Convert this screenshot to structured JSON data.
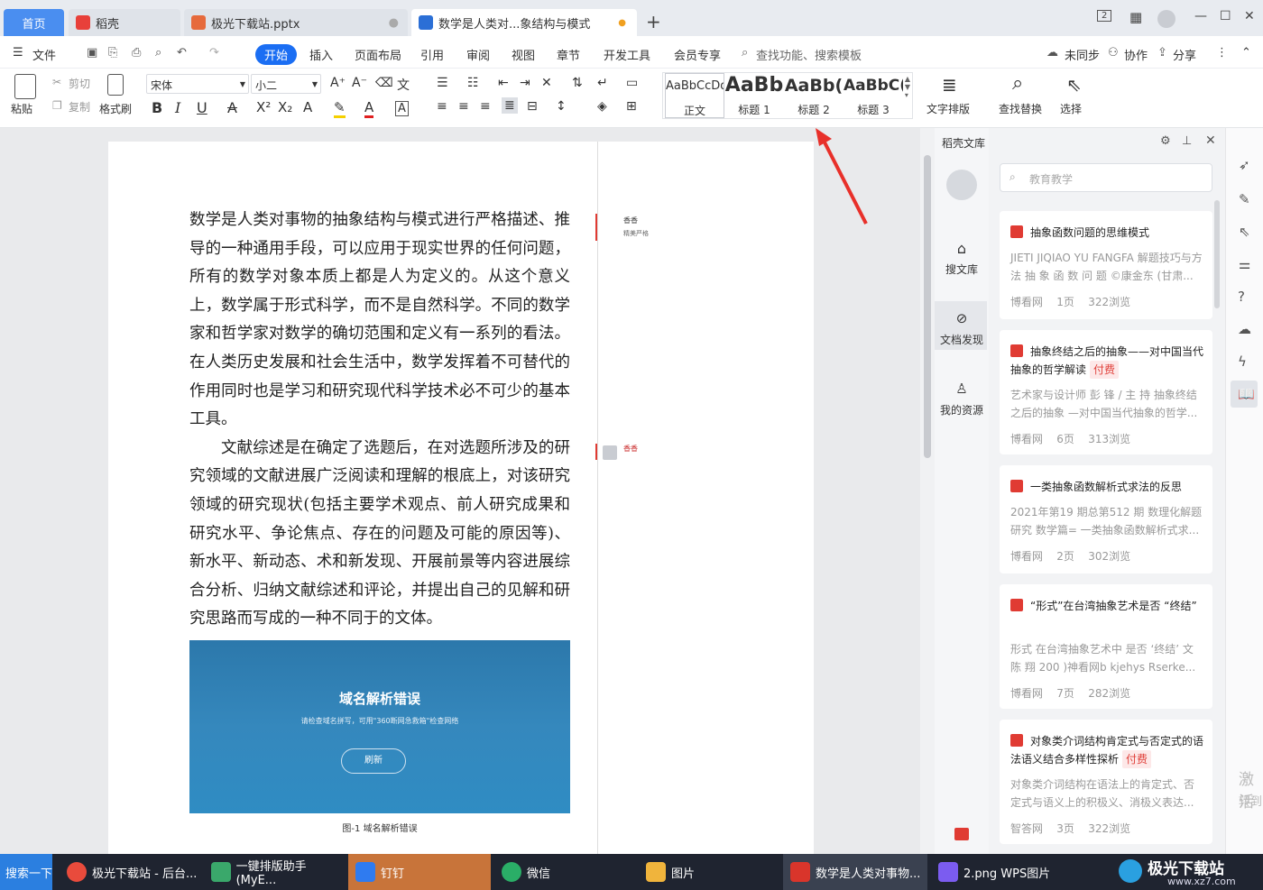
{
  "tabs": {
    "home": "首页",
    "daoke": "稻壳",
    "pptx": "极光下载站.pptx",
    "doc": "数学是人类对...象结构与模式",
    "add": "+"
  },
  "window": {
    "badge": "2"
  },
  "menu": {
    "file": "文件",
    "items": [
      "开始",
      "插入",
      "页面布局",
      "引用",
      "审阅",
      "视图",
      "章节",
      "开发工具",
      "会员专享"
    ],
    "search": "查找功能、搜索模板",
    "sync": "未同步",
    "collab": "协作",
    "share": "分享"
  },
  "ribbon": {
    "paste": "粘贴",
    "cut": "剪切",
    "copy": "复制",
    "format_painter": "格式刷",
    "font": "宋体",
    "size": "小二",
    "styles": [
      {
        "preview": "AaBbCcDd",
        "label": "正文"
      },
      {
        "preview": "AaBb",
        "label": "标题 1"
      },
      {
        "preview": "AaBb(",
        "label": "标题 2"
      },
      {
        "preview": "AaBbC(",
        "label": "标题 3"
      }
    ],
    "text_layout": "文字排版",
    "find_replace": "查找替换",
    "select": "选择"
  },
  "document": {
    "para1": "数学是人类对事物的抽象结构与模式进行严格描述、推导的一种通用手段，可以应用于现实世界的任何问题，所有的数学对象本质上都是人为定义的。从这个意义上，数学属于形式科学，而不是自然科学。不同的数学家和哲学家对数学的确切范围和定义有一系列的看法。在人类历史发展和社会生活中，数学发挥着不可替代的作用同时也是学习和研究现代科学技术必不可少的基本工具。",
    "para2": "文献综述是在确定了选题后，在对选题所涉及的研究领域的文献进展广泛阅读和理解的根底上，对该研究领域的研究现状(包括主要学术观点、前人研究成果和研究水平、争论焦点、存在的问题及可能的原因等)、新水平、新动态、术和新发现、开展前景等内容进展综合分析、归纳文献综述和评论，并提出自己的见解和研究思路而写成的一种不同于的文体。",
    "comment1_author": "香香",
    "comment1_text": "精美严格",
    "comment2_author": "香香",
    "image_title": "域名解析错误",
    "image_sub": "请检查域名拼写，可用\"360断网急救箱\"检查网络",
    "image_btn": "刷新",
    "caption": "图-1 域名解析错误"
  },
  "panel": {
    "title": "稻壳文库",
    "search_placeholder": "教育教学",
    "nav": [
      "搜文库",
      "文档发现",
      "我的资源"
    ],
    "cards": [
      {
        "title": "抽象函数问题的思维模式",
        "fee": "",
        "desc": "JIETI JIQIAO YU FANGFA 解题技巧与方法 抽 象 函 数 问 题 ©康金东 (甘肃...",
        "source": "博看网",
        "pages": "1页",
        "views": "322浏览"
      },
      {
        "title": "抽象终结之后的抽象——对中国当代抽象的哲学解读",
        "fee": "付费",
        "desc": "艺术家与设计师 彭 锋 / 主 持 抽象终结之后的抽象 —对中国当代抽象的哲学...",
        "source": "博看网",
        "pages": "6页",
        "views": "313浏览"
      },
      {
        "title": "一类抽象函数解析式求法的反思",
        "fee": "",
        "desc": "2021年第19 期总第512 期 数理化解题研究 数学篇= 一类抽象函数解析式求...",
        "source": "博看网",
        "pages": "2页",
        "views": "302浏览"
      },
      {
        "title": "“形式”在台湾抽象艺术是否 “终结”",
        "fee": "",
        "desc": "形式 在台湾抽象艺术中 是否 ‘终结’ 文 陈 翔 200 )神看网b kjehys Rserke...",
        "source": "博看网",
        "pages": "7页",
        "views": "282浏览"
      },
      {
        "title": "对象类介词结构肯定式与否定式的语法语义结合多样性探析",
        "fee": "付费",
        "desc": "对象类介词结构在语法上的肯定式、否定式与语义上的积极义、消极义表达...",
        "source": "智答网",
        "pages": "3页",
        "views": "322浏览"
      }
    ],
    "activate": "激活",
    "activate2": "转到"
  },
  "taskbar": [
    {
      "label": "搜索一下",
      "color": "#2b7fe0"
    },
    {
      "label": "极光下载站 - 后台...",
      "color": "#e94b3c"
    },
    {
      "label": "一键排版助手(MyE...",
      "color": "#3aa86b"
    },
    {
      "label": "钉钉",
      "color": "#2f7bf0"
    },
    {
      "label": "微信",
      "color": "#2aae67"
    },
    {
      "label": "图片",
      "color": "#f0b43c"
    },
    {
      "label": "数学是人类对事物...",
      "color": "#d9352b"
    },
    {
      "label": "2.png  WPS图片",
      "color": "#7b5cf0"
    }
  ],
  "watermark": {
    "name": "极光下载站",
    "url": "www.xz7.com"
  }
}
